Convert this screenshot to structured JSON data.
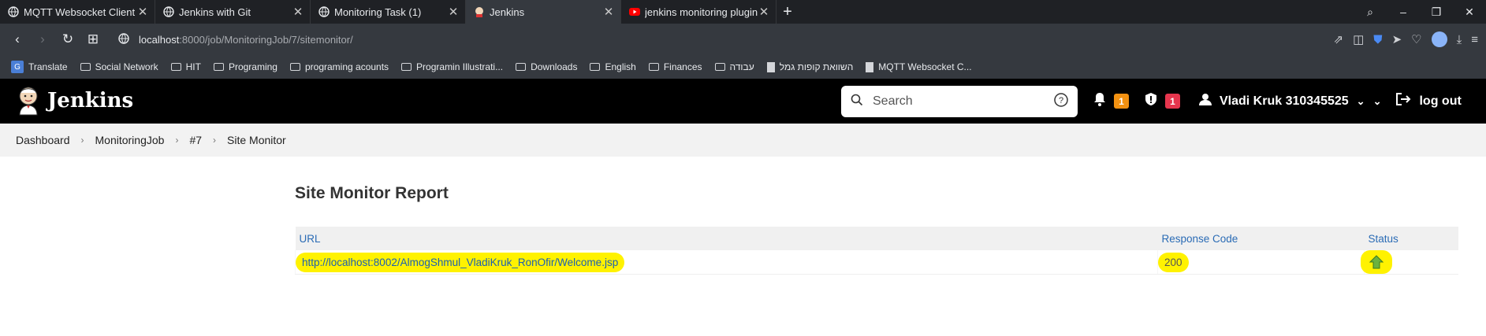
{
  "browser": {
    "tabs": [
      {
        "title": "MQTT Websocket Client",
        "icon": "globe-icon",
        "active": false
      },
      {
        "title": "Jenkins with Git",
        "icon": "globe-icon",
        "active": false
      },
      {
        "title": "Monitoring Task (1)",
        "icon": "globe-icon",
        "active": false
      },
      {
        "title": "Jenkins",
        "icon": "jenkins-icon",
        "active": true
      },
      {
        "title": "jenkins monitoring plugin",
        "icon": "youtube-icon",
        "active": false
      }
    ],
    "url_host": "localhost",
    "url_path": ":8000/job/MonitoringJob/7/sitemonitor/",
    "bookmarks": [
      {
        "label": "Translate",
        "icon": "google-translate-icon"
      },
      {
        "label": "Social Network",
        "icon": "folder-icon"
      },
      {
        "label": "HIT",
        "icon": "folder-icon"
      },
      {
        "label": "Programing",
        "icon": "folder-icon"
      },
      {
        "label": "programing acounts",
        "icon": "folder-icon"
      },
      {
        "label": "Programin Illustrati...",
        "icon": "folder-icon"
      },
      {
        "label": "Downloads",
        "icon": "folder-icon"
      },
      {
        "label": "English",
        "icon": "folder-icon"
      },
      {
        "label": "Finances",
        "icon": "folder-icon"
      },
      {
        "label": "עבודה",
        "icon": "folder-icon"
      },
      {
        "label": "השוואת קופות גמל",
        "icon": "document-icon"
      },
      {
        "label": "MQTT Websocket C...",
        "icon": "document-icon"
      }
    ]
  },
  "jenkins": {
    "title": "Jenkins",
    "search_placeholder": "Search",
    "notifications_count": "1",
    "security_count": "1",
    "user_name": "Vladi Kruk 310345525",
    "logout_label": "log out"
  },
  "breadcrumbs": [
    "Dashboard",
    "MonitoringJob",
    "#7",
    "Site Monitor"
  ],
  "report": {
    "title": "Site Monitor Report",
    "columns": {
      "url": "URL",
      "response_code": "Response Code",
      "status": "Status"
    },
    "rows": [
      {
        "url": "http://localhost:8002/AlmogShmul_VladiKruk_RonOfir/Welcome.jsp",
        "response_code": "200",
        "status": "up-arrow-icon"
      }
    ]
  },
  "colors": {
    "highlight": "#fff200",
    "link_blue": "#2a6bb5",
    "badge_orange": "#f29111",
    "badge_red": "#e6354d"
  }
}
